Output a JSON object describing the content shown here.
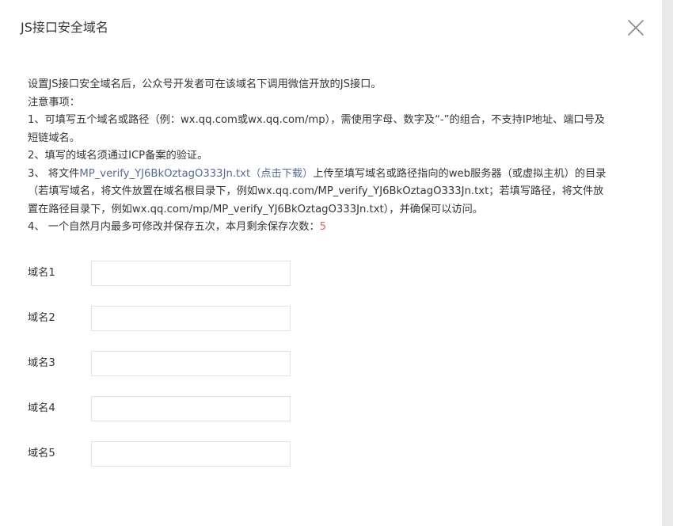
{
  "dialog": {
    "title": "JS接口安全域名",
    "close_icon": "close-icon"
  },
  "description": {
    "intro": "设置JS接口安全域名后，公众号开发者可在该域名下调用微信开放的JS接口。",
    "notes_title": "注意事项：",
    "note1_line1": "1、可填写五个域名或路径（例：wx.qq.com或wx.qq.com/mp），需使用字母、数字及“-”的组合，不支持IP地址、端口号及",
    "note1_line2": "短链域名。",
    "note2": "2、填写的域名须通过ICP备案的验证。",
    "note3_prefix": "3、 将文件",
    "note3_link": "MP_verify_YJ6BkOztagO333Jn.txt（点击下载）",
    "note3_suffix": "上传至填写域名或路径指向的web服务器（或虚拟主机）的目录",
    "note3_line2": "（若填写域名，将文件放置在域名根目录下，例如wx.qq.com/MP_verify_YJ6BkOztagO333Jn.txt；若填写路径，将文件放",
    "note3_line3": "置在路径目录下，例如wx.qq.com/mp/MP_verify_YJ6BkOztagO333Jn.txt），并确保可以访问。",
    "note4_prefix": "4、 一个自然月内最多可修改并保存五次，本月剩余保存次数：",
    "note4_count": "5"
  },
  "form": {
    "fields": [
      {
        "label": "域名1",
        "value": ""
      },
      {
        "label": "域名2",
        "value": ""
      },
      {
        "label": "域名3",
        "value": ""
      },
      {
        "label": "域名4",
        "value": ""
      },
      {
        "label": "域名5",
        "value": ""
      }
    ]
  },
  "colors": {
    "link": "#576b95",
    "count": "#e15f63",
    "text": "#353535"
  }
}
